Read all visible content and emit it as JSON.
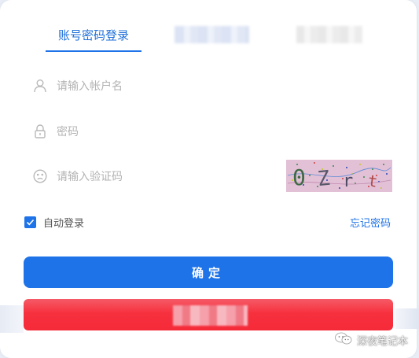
{
  "tabs": {
    "active_label": "账号密码登录"
  },
  "fields": {
    "username_placeholder": "请输入帐户名",
    "password_placeholder": "密码",
    "captcha_placeholder": "请输入验证码",
    "captcha_text": "0Zrt"
  },
  "icons": {
    "username": "user-icon",
    "password": "lock-icon",
    "captcha": "face-icon",
    "checkbox": "checkmark-icon",
    "watermark": "wechat-icon"
  },
  "remember": {
    "label": "自动登录",
    "checked": true
  },
  "forgot": {
    "label": "忘记密码"
  },
  "submit": {
    "label": "确定"
  },
  "watermark": {
    "text": "深夜笔记本"
  },
  "colors": {
    "accent": "#1e73e8",
    "placeholder": "#b3b3b3",
    "captcha_bg": "#e2c0d6",
    "redaction": "#f52a39"
  }
}
